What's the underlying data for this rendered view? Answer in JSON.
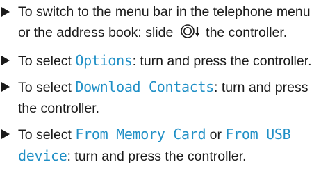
{
  "steps": [
    {
      "parts": [
        "To switch to the menu bar in the telephone menu or the address book: slide",
        "the controller."
      ]
    },
    {
      "parts": [
        "To select",
        "Options",
        ": turn and press the controller."
      ]
    },
    {
      "parts": [
        "To select",
        "Download Contacts",
        ": turn and press the controller."
      ]
    },
    {
      "parts": [
        "To select",
        "From Memory Card",
        "or",
        "From USB device",
        ": turn and press the controller."
      ]
    }
  ],
  "icons": {
    "bullet": "right-triangle-bullet",
    "controller_slide": "controller-slide-down-icon"
  },
  "colors": {
    "text": "#1a1a1a",
    "menu_term": "#1f8fc6"
  }
}
